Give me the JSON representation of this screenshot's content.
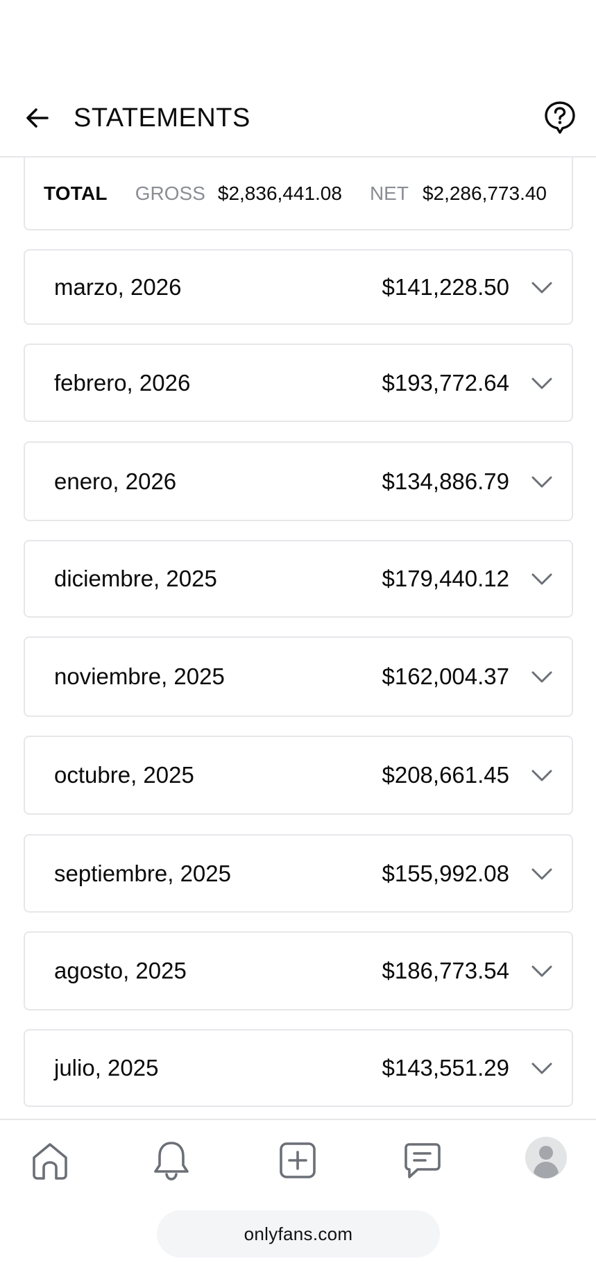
{
  "header": {
    "title": "STATEMENTS",
    "back_icon": "arrow-left-icon",
    "help_icon": "help-bubble-icon"
  },
  "total": {
    "label": "TOTAL",
    "gross_label": "GROSS",
    "gross_value": "$2,836,441.08",
    "net_label": "NET",
    "net_value": "$2,286,773.40"
  },
  "statements": [
    {
      "month": "marzo, 2026",
      "amount": "$141,228.50"
    },
    {
      "month": "febrero, 2026",
      "amount": "$193,772.64"
    },
    {
      "month": "enero, 2026",
      "amount": "$134,886.79"
    },
    {
      "month": "diciembre, 2025",
      "amount": "$179,440.12"
    },
    {
      "month": "noviembre, 2025",
      "amount": "$162,004.37"
    },
    {
      "month": "octubre, 2025",
      "amount": "$208,661.45"
    },
    {
      "month": "septiembre, 2025",
      "amount": "$155,992.08"
    },
    {
      "month": "agosto, 2025",
      "amount": "$186,773.54"
    },
    {
      "month": "julio, 2025",
      "amount": "$143,551.29"
    }
  ],
  "bottom_nav": {
    "items": [
      "home-icon",
      "bell-icon",
      "plus-square-icon",
      "chat-icon",
      "avatar"
    ]
  },
  "browser": {
    "url": "onlyfans.com"
  },
  "colors": {
    "border": "#e6e7ea",
    "muted_text": "#8a8d93",
    "icon": "#6b6f76"
  }
}
